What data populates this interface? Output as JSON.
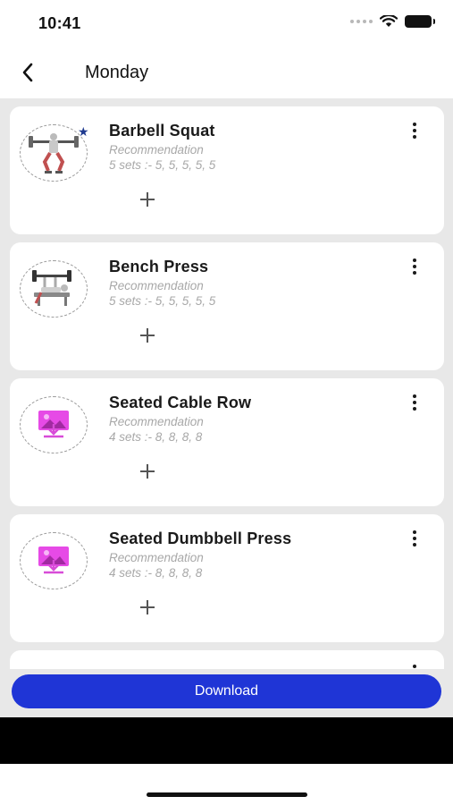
{
  "status_bar": {
    "time": "10:41"
  },
  "nav": {
    "title": "Monday"
  },
  "exercises": [
    {
      "name": "Barbell Squat",
      "recommendation": "Recommendation",
      "sets": "5 sets :- 5, 5, 5, 5, 5",
      "favorite": true,
      "thumbnail": "barbell-squat-illustration"
    },
    {
      "name": "Bench Press",
      "recommendation": "Recommendation",
      "sets": "5 sets :- 5, 5, 5, 5, 5",
      "favorite": false,
      "thumbnail": "bench-press-illustration"
    },
    {
      "name": "Seated Cable Row",
      "recommendation": "Recommendation",
      "sets": "4 sets :- 8, 8, 8, 8",
      "favorite": false,
      "thumbnail": "image-placeholder-icon"
    },
    {
      "name": "Seated Dumbbell Press",
      "recommendation": "Recommendation",
      "sets": "4 sets :- 8, 8, 8, 8",
      "favorite": false,
      "thumbnail": "image-placeholder-icon"
    }
  ],
  "footer": {
    "download_label": "Download"
  },
  "colors": {
    "accent": "#1f35d6",
    "star": "#1f3a8f",
    "placeholder": "#e64ae6",
    "background": "#e8e8e8"
  }
}
